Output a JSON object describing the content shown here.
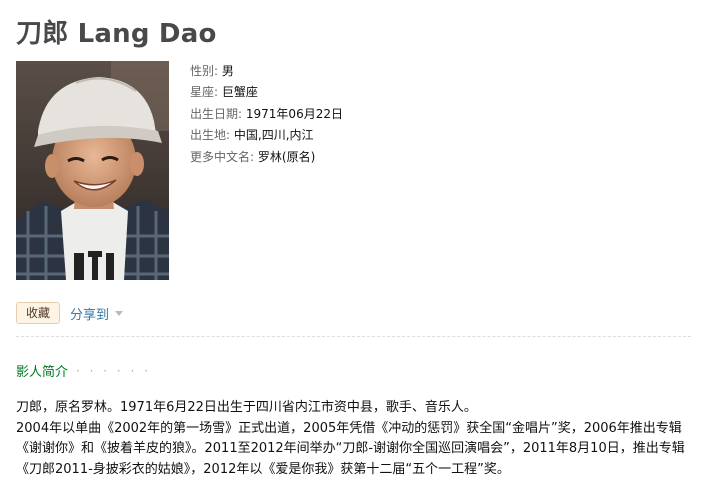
{
  "person": {
    "title": "刀郎 Lang Dao",
    "photo_icon": "portrait-photo"
  },
  "info": [
    {
      "label": "性别",
      "value": "男"
    },
    {
      "label": "星座",
      "value": "巨蟹座"
    },
    {
      "label": "出生日期",
      "value": "1971年06月22日"
    },
    {
      "label": "出生地",
      "value": "中国,四川,内江"
    },
    {
      "label": "更多中文名",
      "value": "罗林(原名)"
    }
  ],
  "separator": ":",
  "actions": {
    "collect_label": "收藏",
    "share_label": "分享到",
    "share_caret_icon": "caret-down-icon"
  },
  "section": {
    "title": "影人简介",
    "dots": "· · · · · ·"
  },
  "bio": {
    "line1": "刀郎，原名罗林。1971年6月22日出生于四川省内江市资中县，歌手、音乐人。",
    "line2": "2004年以单曲《2002年的第一场雪》正式出道，2005年凭借《冲动的惩罚》获全国“金唱片”奖，2006年推出专辑《谢谢你》和《披着羊皮的狼》。2011至2012年间举办“刀郎-谢谢你全国巡回演唱会”，2011年8月10日，推出专辑《刀郎2011-身披彩衣的姑娘》，2012年以《爱是你我》获第十二届“五个一工程”奖。"
  },
  "colors": {
    "title": "#494949",
    "label": "#666666",
    "link": "#3377aa",
    "section": "#007722",
    "button_bg": "#fdf4e6",
    "button_border": "#e7cfad"
  }
}
